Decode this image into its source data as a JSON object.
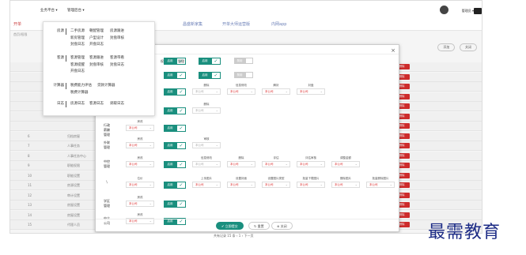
{
  "topbar": {
    "nav1": "业务平台 ▾",
    "nav2": "管理后台 ▾",
    "user": "管理员 ▾"
  },
  "tabs": [
    "开单",
    "官方网站",
    "昌盛新家集",
    "开单大师运营版",
    "内网app"
  ],
  "crumb": "首页/权限",
  "toolbar": {
    "add": "添加",
    "close": "关闭"
  },
  "bgrows": [
    {
      "idx": "",
      "name": "",
      "tag": "删除"
    },
    {
      "idx": "",
      "name": "",
      "tag": "删除"
    },
    {
      "idx": "",
      "name": "",
      "tag": "删除"
    },
    {
      "idx": "",
      "name": "",
      "tag": "删除"
    },
    {
      "idx": "",
      "name": "",
      "tag": "删除"
    },
    {
      "idx": "",
      "name": "",
      "tag": "删除"
    },
    {
      "idx": "",
      "name": "",
      "tag": "删除"
    },
    {
      "idx": "6",
      "name": "归档房屋",
      "tag": "删除"
    },
    {
      "idx": "7",
      "name": "人事任务",
      "tag": "删除"
    },
    {
      "idx": "8",
      "name": "人事任务中心",
      "tag": "删除"
    },
    {
      "idx": "9",
      "name": "职能权限",
      "tag": "删除"
    },
    {
      "idx": "10",
      "name": "职能设置",
      "tag": "删除"
    },
    {
      "idx": "11",
      "name": "房源设置",
      "tag": "删除"
    },
    {
      "idx": "12",
      "name": "审计设置",
      "tag": "删除"
    },
    {
      "idx": "13",
      "name": "房屋设置",
      "tag": "删除"
    },
    {
      "idx": "14",
      "name": "房屋设置",
      "tag": "删除"
    },
    {
      "idx": "15",
      "name": "代理人员",
      "tag": "删除"
    }
  ],
  "menu": [
    {
      "cat": "房源",
      "items": [
        "二手房源",
        "朝配管理",
        "房源跟进",
        "新房管理",
        "户型设计",
        "封盘审核",
        "封盘日志",
        "开盘日志"
      ]
    },
    {
      "cat": "客源",
      "items": [
        "客源管理",
        "客源跟进",
        "客源带看",
        "客源提醒",
        "封盘审核",
        "封盘日志",
        "开盘日志"
      ]
    },
    {
      "cat": "计算器",
      "items": [
        "税费能力评估",
        "贷款计算器",
        "税费计算器"
      ]
    },
    {
      "cat": "日志",
      "items": [
        "房源日志",
        "客源日志",
        "调取日志"
      ]
    }
  ],
  "modal": {
    "tabs": [
      "权限",
      "权限",
      "管理"
    ],
    "rows": [
      {
        "label": "",
        "fields": []
      },
      {
        "label": "",
        "fields": []
      },
      {
        "label": "",
        "fields": [
          [
            "房源",
            "本公司"
          ],
          [
            "删除",
            "本公司"
          ],
          [
            "信息修改",
            "本公司"
          ],
          [
            "解封",
            "本公司"
          ],
          [
            "封盘",
            "本公司"
          ]
        ]
      },
      {
        "label": "",
        "fields": [
          [
            "房改",
            "本公司"
          ],
          [
            "删除",
            "本公司"
          ]
        ]
      },
      {
        "label": "行政\n薪酬\n管理",
        "fields": [
          [
            "房改",
            "本公司"
          ]
        ]
      },
      {
        "label": "外联\n管理",
        "fields": [
          [
            "房改",
            "本公司"
          ],
          [
            "审核",
            "本公司"
          ]
        ]
      },
      {
        "label": "中控\n管理",
        "fields": [
          [
            "房改",
            "本公司"
          ],
          [
            "信息修改",
            "本公司"
          ],
          [
            "删除",
            "本公司"
          ],
          [
            "评估",
            "本公司"
          ],
          [
            "评估审核",
            "本公司"
          ],
          [
            "调整金额",
            "本公司"
          ]
        ]
      },
      {
        "label": "\\",
        "fields": [
          [
            "位价",
            "本公司"
          ],
          [
            "上传图片",
            "本公司"
          ],
          [
            "设置封面",
            "本公司"
          ],
          [
            "设置图片类型",
            "本公司"
          ],
          [
            "批量下载图片",
            "本公司"
          ],
          [
            "删除图片",
            "本公司"
          ],
          [
            "批量删除图片",
            "本公司"
          ]
        ]
      },
      {
        "label": "学区\n管理",
        "fields": [
          [
            "房改",
            "本公司"
          ]
        ]
      },
      {
        "label": "中介\n公司",
        "fields": [
          [
            "房改",
            "本公司"
          ]
        ]
      }
    ],
    "toggle_on": "启用",
    "toggle_off": "禁用",
    "check": "✓",
    "footer": {
      "save": "✔ 立即提交",
      "reset": "↻ 重置",
      "close": "⊗ 关闭"
    }
  },
  "pager": "共有记录 15 条  ‹ 1 › 下一页",
  "watermark": "最需教育"
}
